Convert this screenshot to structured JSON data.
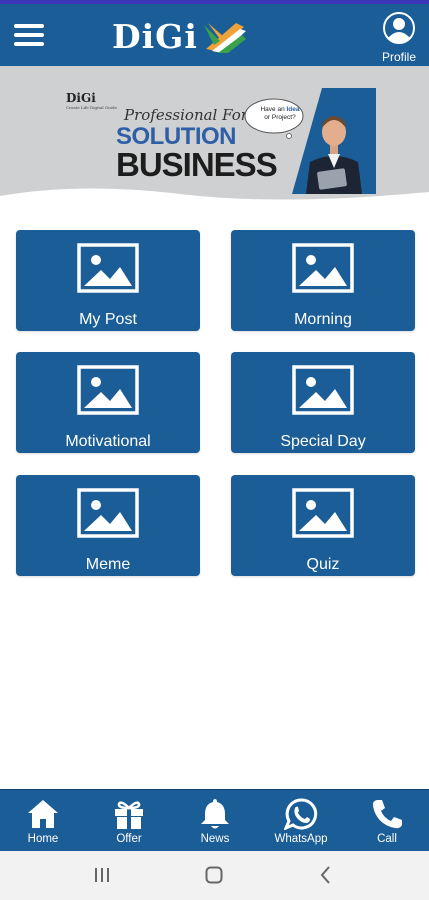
{
  "header": {
    "brand": "DiGi",
    "profile_label": "Profile"
  },
  "banner": {
    "logo": "DiGi",
    "logo_tagline": "Create Life Digital Guide",
    "script_text": "Professional",
    "script_text_2": "For Your",
    "headline_1": "SOLUTION",
    "headline_2": "BUSINESS",
    "bubble_line_1": "Have an",
    "bubble_highlight": "Idea",
    "bubble_line_2": "or Project?"
  },
  "tiles": [
    {
      "label": "My Post"
    },
    {
      "label": "Morning"
    },
    {
      "label": "Motivational"
    },
    {
      "label": "Special Day"
    },
    {
      "label": "Meme"
    },
    {
      "label": "Quiz"
    }
  ],
  "bottom_nav": [
    {
      "label": "Home",
      "icon": "home-icon"
    },
    {
      "label": "Offer",
      "icon": "gift-icon"
    },
    {
      "label": "News",
      "icon": "bell-icon"
    },
    {
      "label": "WhatsApp",
      "icon": "whatsapp-icon"
    },
    {
      "label": "Call",
      "icon": "phone-icon"
    }
  ],
  "colors": {
    "primary": "#1b5d96",
    "status_accent": "#3e36b8",
    "banner_bg": "#cfd0d2",
    "system_bar": "#f2f2f2"
  }
}
